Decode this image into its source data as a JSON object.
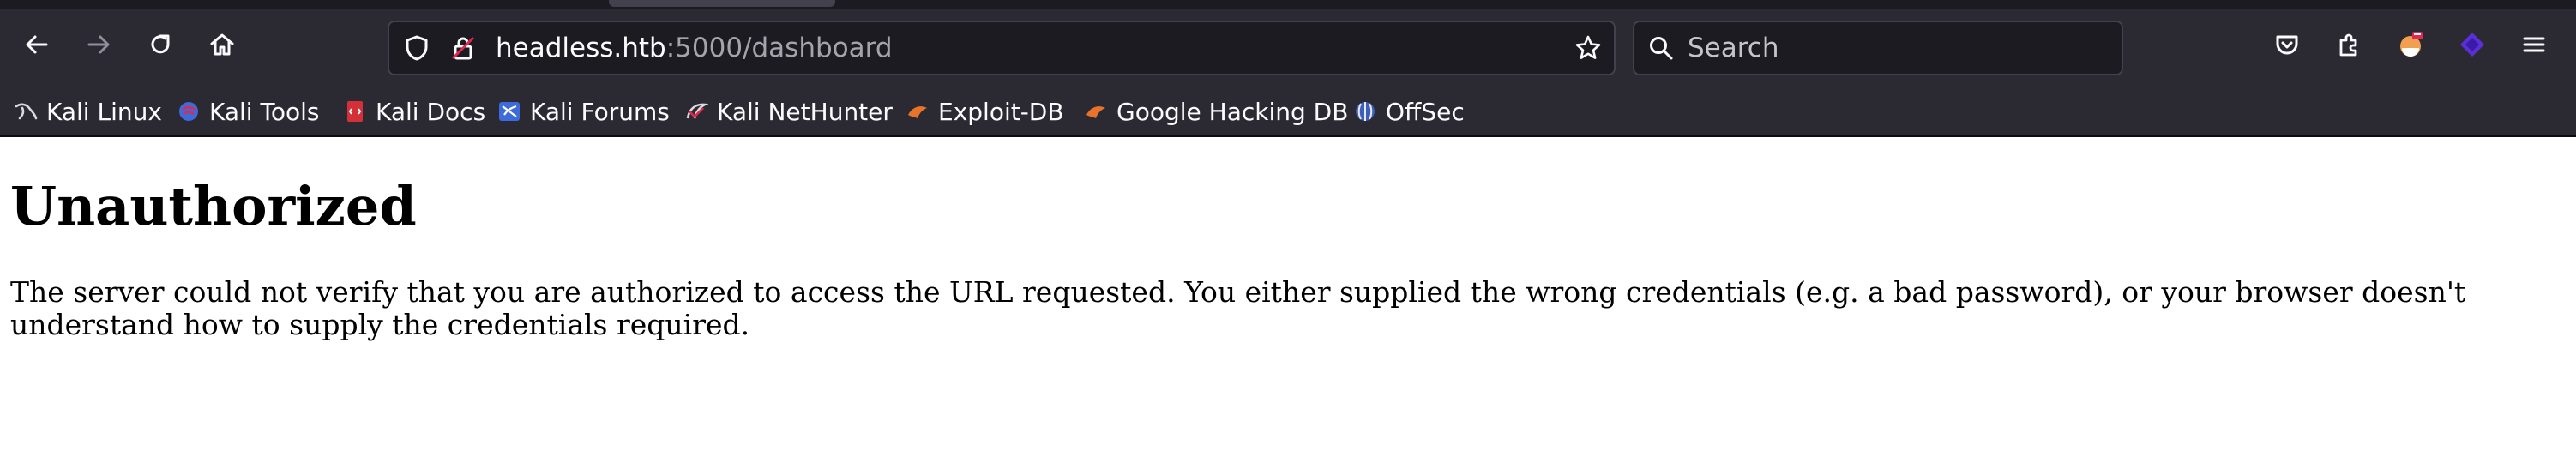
{
  "browser": {
    "url_host": "headless.htb",
    "url_rest": ":5000/dashboard",
    "search_placeholder": "Search",
    "nav": {
      "back_icon": "arrow-left-icon",
      "forward_icon": "arrow-right-icon",
      "reload_icon": "reload-icon",
      "home_icon": "home-icon"
    },
    "toolbar_icons": [
      "pocket-icon",
      "extensions-icon",
      "profile-icon",
      "addon-icon",
      "menu-icon"
    ]
  },
  "bookmarks": [
    {
      "label": "Kali Linux",
      "icon": "kali-dragon-icon"
    },
    {
      "label": "Kali Tools",
      "icon": "kali-tools-icon"
    },
    {
      "label": "Kali Docs",
      "icon": "kali-docs-icon"
    },
    {
      "label": "Kali Forums",
      "icon": "kali-forums-icon"
    },
    {
      "label": "Kali NetHunter",
      "icon": "kali-nethunter-icon"
    },
    {
      "label": "Exploit-DB",
      "icon": "exploit-db-icon"
    },
    {
      "label": "Google Hacking DB",
      "icon": "ghdb-icon"
    },
    {
      "label": "OffSec",
      "icon": "offsec-icon"
    }
  ],
  "page": {
    "title": "Unauthorized",
    "message": "The server could not verify that you are authorized to access the URL requested. You either supplied the wrong credentials (e.g. a bad password), or your browser doesn't understand how to supply the credentials required."
  },
  "colors": {
    "chrome_bg": "#2b2a33",
    "field_bg": "#1c1b22",
    "text_light": "#fbfbfe",
    "text_dim": "#a5a4ad"
  }
}
